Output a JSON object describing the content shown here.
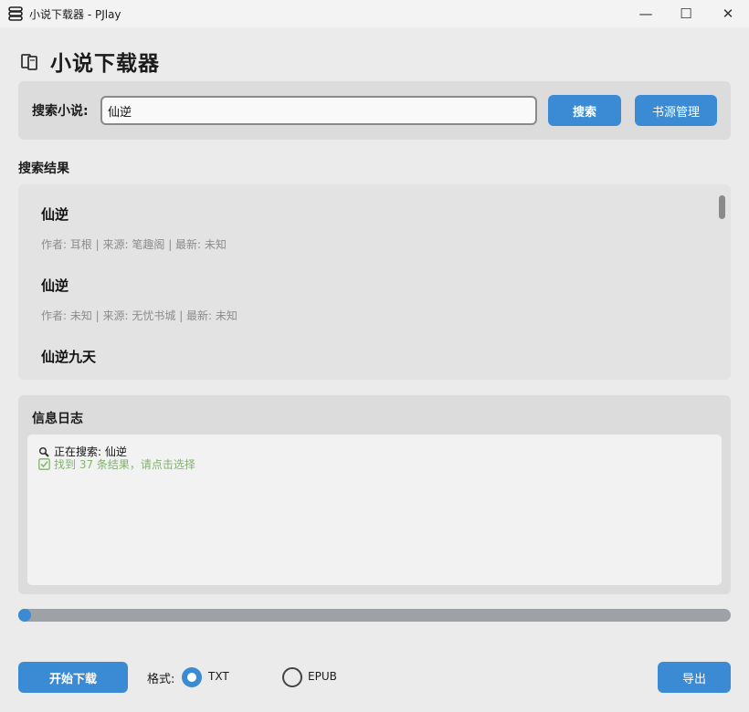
{
  "window": {
    "title": "小说下载器 - PJlay",
    "min_glyph": "—",
    "max_glyph": "☐",
    "close_glyph": "✕"
  },
  "header": {
    "title": "小说下载器",
    "icon": "books-icon"
  },
  "search": {
    "label": "搜索小说:",
    "value": "仙逆",
    "search_button": "搜索",
    "source_button": "书源管理"
  },
  "results": {
    "title": "搜索结果",
    "items": [
      {
        "name": "仙逆",
        "meta": "作者: 耳根 | 来源: 笔趣阁 | 最新: 未知"
      },
      {
        "name": "仙逆",
        "meta": "作者: 未知 | 来源: 无忧书城 | 最新: 未知"
      },
      {
        "name": "仙逆九天",
        "meta": ""
      }
    ]
  },
  "log": {
    "title": "信息日志",
    "lines": [
      {
        "icon": "magnifier-icon",
        "text": "正在搜索: 仙逆"
      },
      {
        "icon": "checkmark-icon",
        "text": "找到 37 条结果，请点击选择"
      }
    ]
  },
  "progress": {
    "value": 0.01
  },
  "bottom": {
    "start_button": "开始下载",
    "format_label": "格式:",
    "formats": [
      "TXT",
      "EPUB"
    ],
    "selected_format": "TXT",
    "export_button": "导出"
  },
  "colors": {
    "accent": "#3a8ad4",
    "success_text": "#7fb56a"
  }
}
